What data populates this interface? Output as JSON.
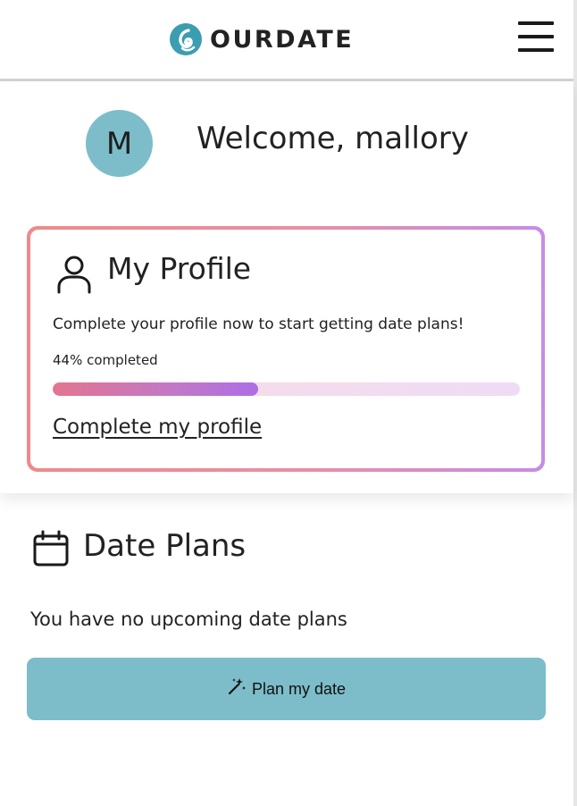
{
  "header": {
    "brand_name": "OURDATE",
    "logo_icon": "ourdate-logo-icon",
    "menu_icon": "hamburger-menu-icon"
  },
  "user": {
    "avatar_initial": "M",
    "welcome_text": "Welcome, mallory"
  },
  "profile_card": {
    "icon": "person-icon",
    "title": "My Profile",
    "description": "Complete your profile now to start getting date plans!",
    "progress_text": "44% completed",
    "progress_fraction": 0.44,
    "link_label": "Complete my profile"
  },
  "date_plans": {
    "icon": "calendar-icon",
    "title": "Date Plans",
    "empty_text": "You have no upcoming date plans",
    "button_icon": "magic-wand-icon",
    "button_label": "Plan my date"
  },
  "colors": {
    "accent_teal": "#7dbdc9",
    "gradient_start": "#ef8a8a",
    "gradient_end": "#c58ce6",
    "progress_fill_end": "#ad6ee4"
  }
}
